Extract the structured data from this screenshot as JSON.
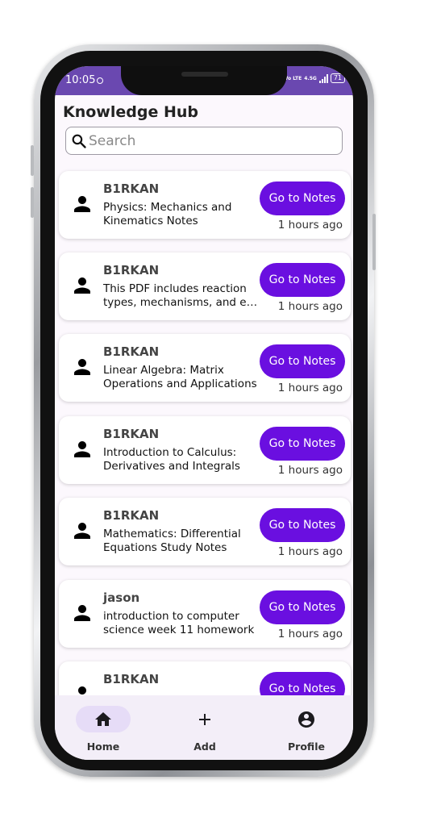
{
  "status_bar": {
    "time": "10:05",
    "network_label": "Vo LTE",
    "network_type": "4.5G",
    "battery": "71"
  },
  "header": {
    "title": "Knowledge Hub"
  },
  "search": {
    "placeholder": "Search",
    "value": ""
  },
  "notes": [
    {
      "author": "B1RKAN",
      "title": "Physics: Mechanics and Kinematics Notes",
      "button_label": "Go to Notes",
      "time": "1 hours ago"
    },
    {
      "author": "B1RKAN",
      "title": "This PDF includes reaction types, mechanisms, and e…",
      "button_label": "Go to Notes",
      "time": "1 hours ago"
    },
    {
      "author": "B1RKAN",
      "title": "Linear Algebra: Matrix Operations and Applications",
      "button_label": "Go to Notes",
      "time": "1 hours ago"
    },
    {
      "author": "B1RKAN",
      "title": "Introduction to Calculus: Derivatives and Integrals",
      "button_label": "Go to Notes",
      "time": "1 hours ago"
    },
    {
      "author": "B1RKAN",
      "title": "Mathematics: Differential Equations Study Notes",
      "button_label": "Go to Notes",
      "time": "1 hours ago"
    },
    {
      "author": "jason",
      "title": "introduction to computer science week 11 homework",
      "button_label": "Go to Notes",
      "time": "1 hours ago"
    },
    {
      "author": "B1RKAN",
      "title": "",
      "button_label": "Go to Notes",
      "time": ""
    }
  ],
  "bottom_nav": {
    "items": [
      {
        "label": "Home",
        "icon": "home-icon",
        "active": true
      },
      {
        "label": "Add",
        "icon": "plus-icon",
        "active": false
      },
      {
        "label": "Profile",
        "icon": "account-circle-icon",
        "active": false
      }
    ]
  },
  "colors": {
    "status_bar": "#6a48b0",
    "accent_button": "#6a0fe0",
    "background": "#fcf8fd",
    "nav_background": "#f3eef8",
    "nav_active_pill": "#e6dcf7"
  }
}
